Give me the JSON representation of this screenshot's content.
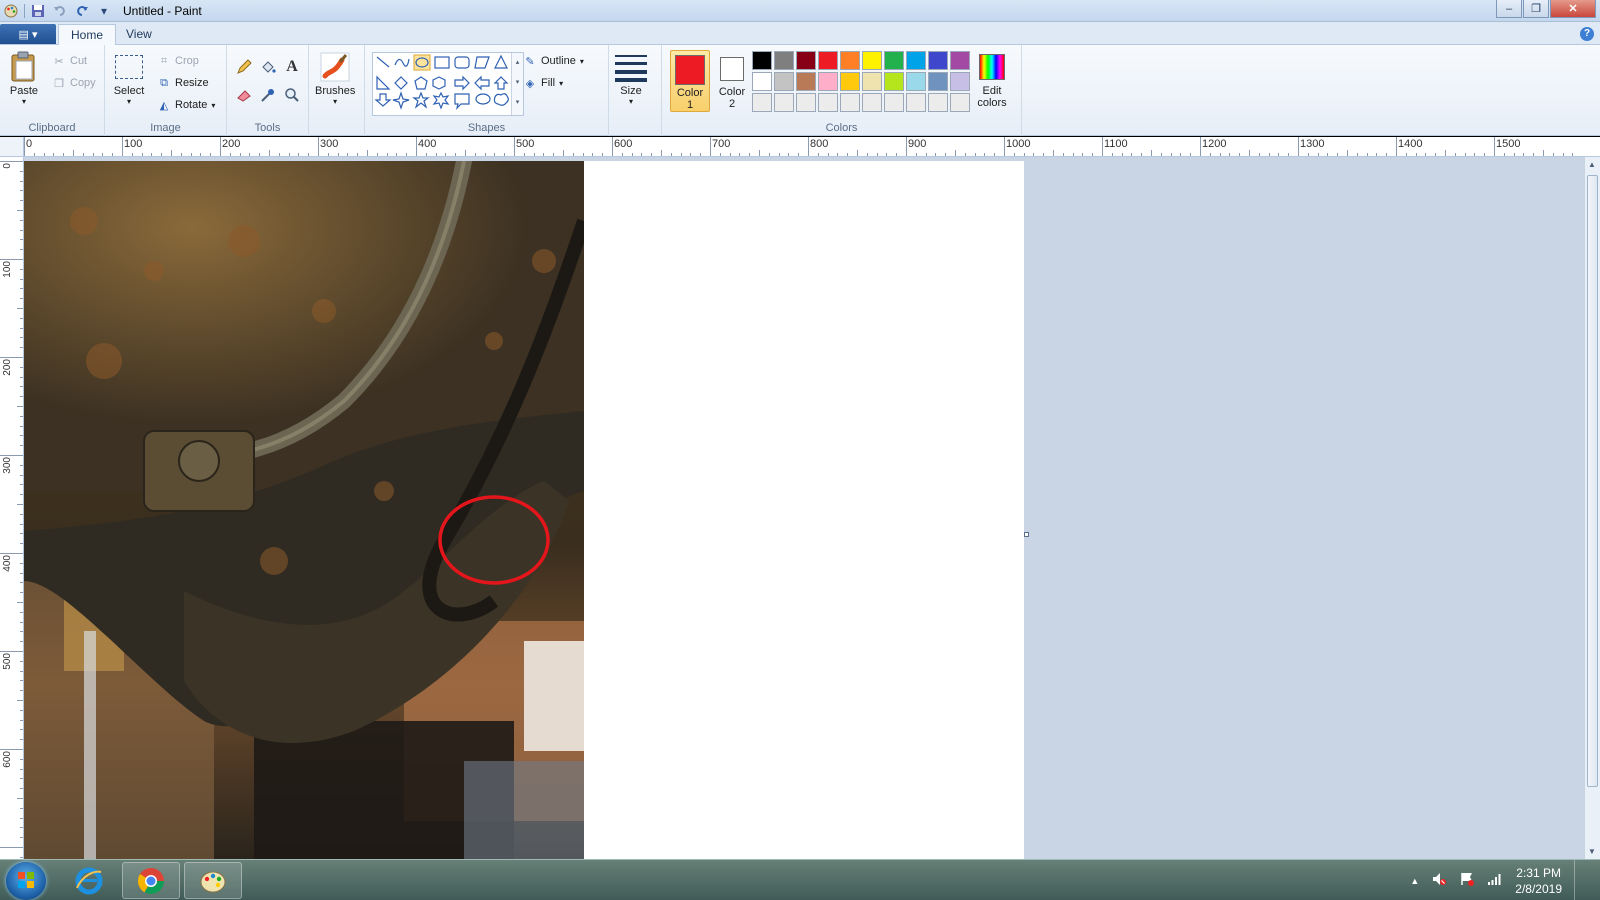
{
  "window": {
    "title": "Untitled - Paint",
    "minimize_glyph": "‒",
    "maximize_glyph": "❐",
    "close_glyph": "✕"
  },
  "quick_access": {
    "app_icon": "paint-palette-icon",
    "save_icon": "save-icon",
    "undo_icon": "undo-icon",
    "redo_icon": "redo-icon",
    "customize_icon": "dropdown-arrow-icon"
  },
  "tabs": {
    "file_glyph": "▤ ▾",
    "items": [
      {
        "label": "Home",
        "active": true
      },
      {
        "label": "View",
        "active": false
      }
    ],
    "help_glyph": "?"
  },
  "ribbon": {
    "clipboard": {
      "label": "Clipboard",
      "paste": "Paste",
      "cut": "Cut",
      "copy": "Copy"
    },
    "image": {
      "label": "Image",
      "select": "Select",
      "crop": "Crop",
      "resize": "Resize",
      "rotate": "Rotate"
    },
    "tools": {
      "label": "Tools",
      "items": [
        "pencil-icon",
        "fill-bucket-icon",
        "text-icon",
        "eraser-icon",
        "color-picker-icon",
        "magnifier-icon"
      ]
    },
    "brushes": {
      "label": "Brushes"
    },
    "shapes": {
      "label": "Shapes",
      "outline": "Outline",
      "fill": "Fill"
    },
    "size": {
      "label": "Size"
    },
    "colors": {
      "label": "Colors",
      "color1_line1": "Color",
      "color1_line2": "1",
      "color2_line1": "Color",
      "color2_line2": "2",
      "edit_line1": "Edit",
      "edit_line2": "colors",
      "color1": "#ed1c24",
      "color2": "#ffffff",
      "palette": [
        "#000000",
        "#7f7f7f",
        "#880015",
        "#ed1c24",
        "#ff7f27",
        "#fff200",
        "#22b14c",
        "#00a2e8",
        "#3f48cc",
        "#a349a4",
        "#ffffff",
        "#c3c3c3",
        "#b97a57",
        "#ffaec9",
        "#ffc90e",
        "#efe4b0",
        "#b5e61d",
        "#99d9ea",
        "#7092be",
        "#c8bfe7",
        "#ececec",
        "#ececec",
        "#ececec",
        "#ececec",
        "#ececec",
        "#ececec",
        "#ececec",
        "#ececec",
        "#ececec",
        "#ececec"
      ]
    }
  },
  "rulers": {
    "h_labels": [
      "0",
      "100",
      "200",
      "300",
      "400",
      "500",
      "600",
      "700",
      "800",
      "900",
      "1000",
      "1100",
      "1200",
      "1300",
      "1400",
      "1500"
    ],
    "v_labels": [
      "0",
      "100",
      "200",
      "300",
      "400",
      "500",
      "600"
    ]
  },
  "taskbar": {
    "apps": [
      "internet-explorer-icon",
      "chrome-icon",
      "paint-icon"
    ],
    "time": "2:31 PM",
    "date": "2/8/2019"
  }
}
